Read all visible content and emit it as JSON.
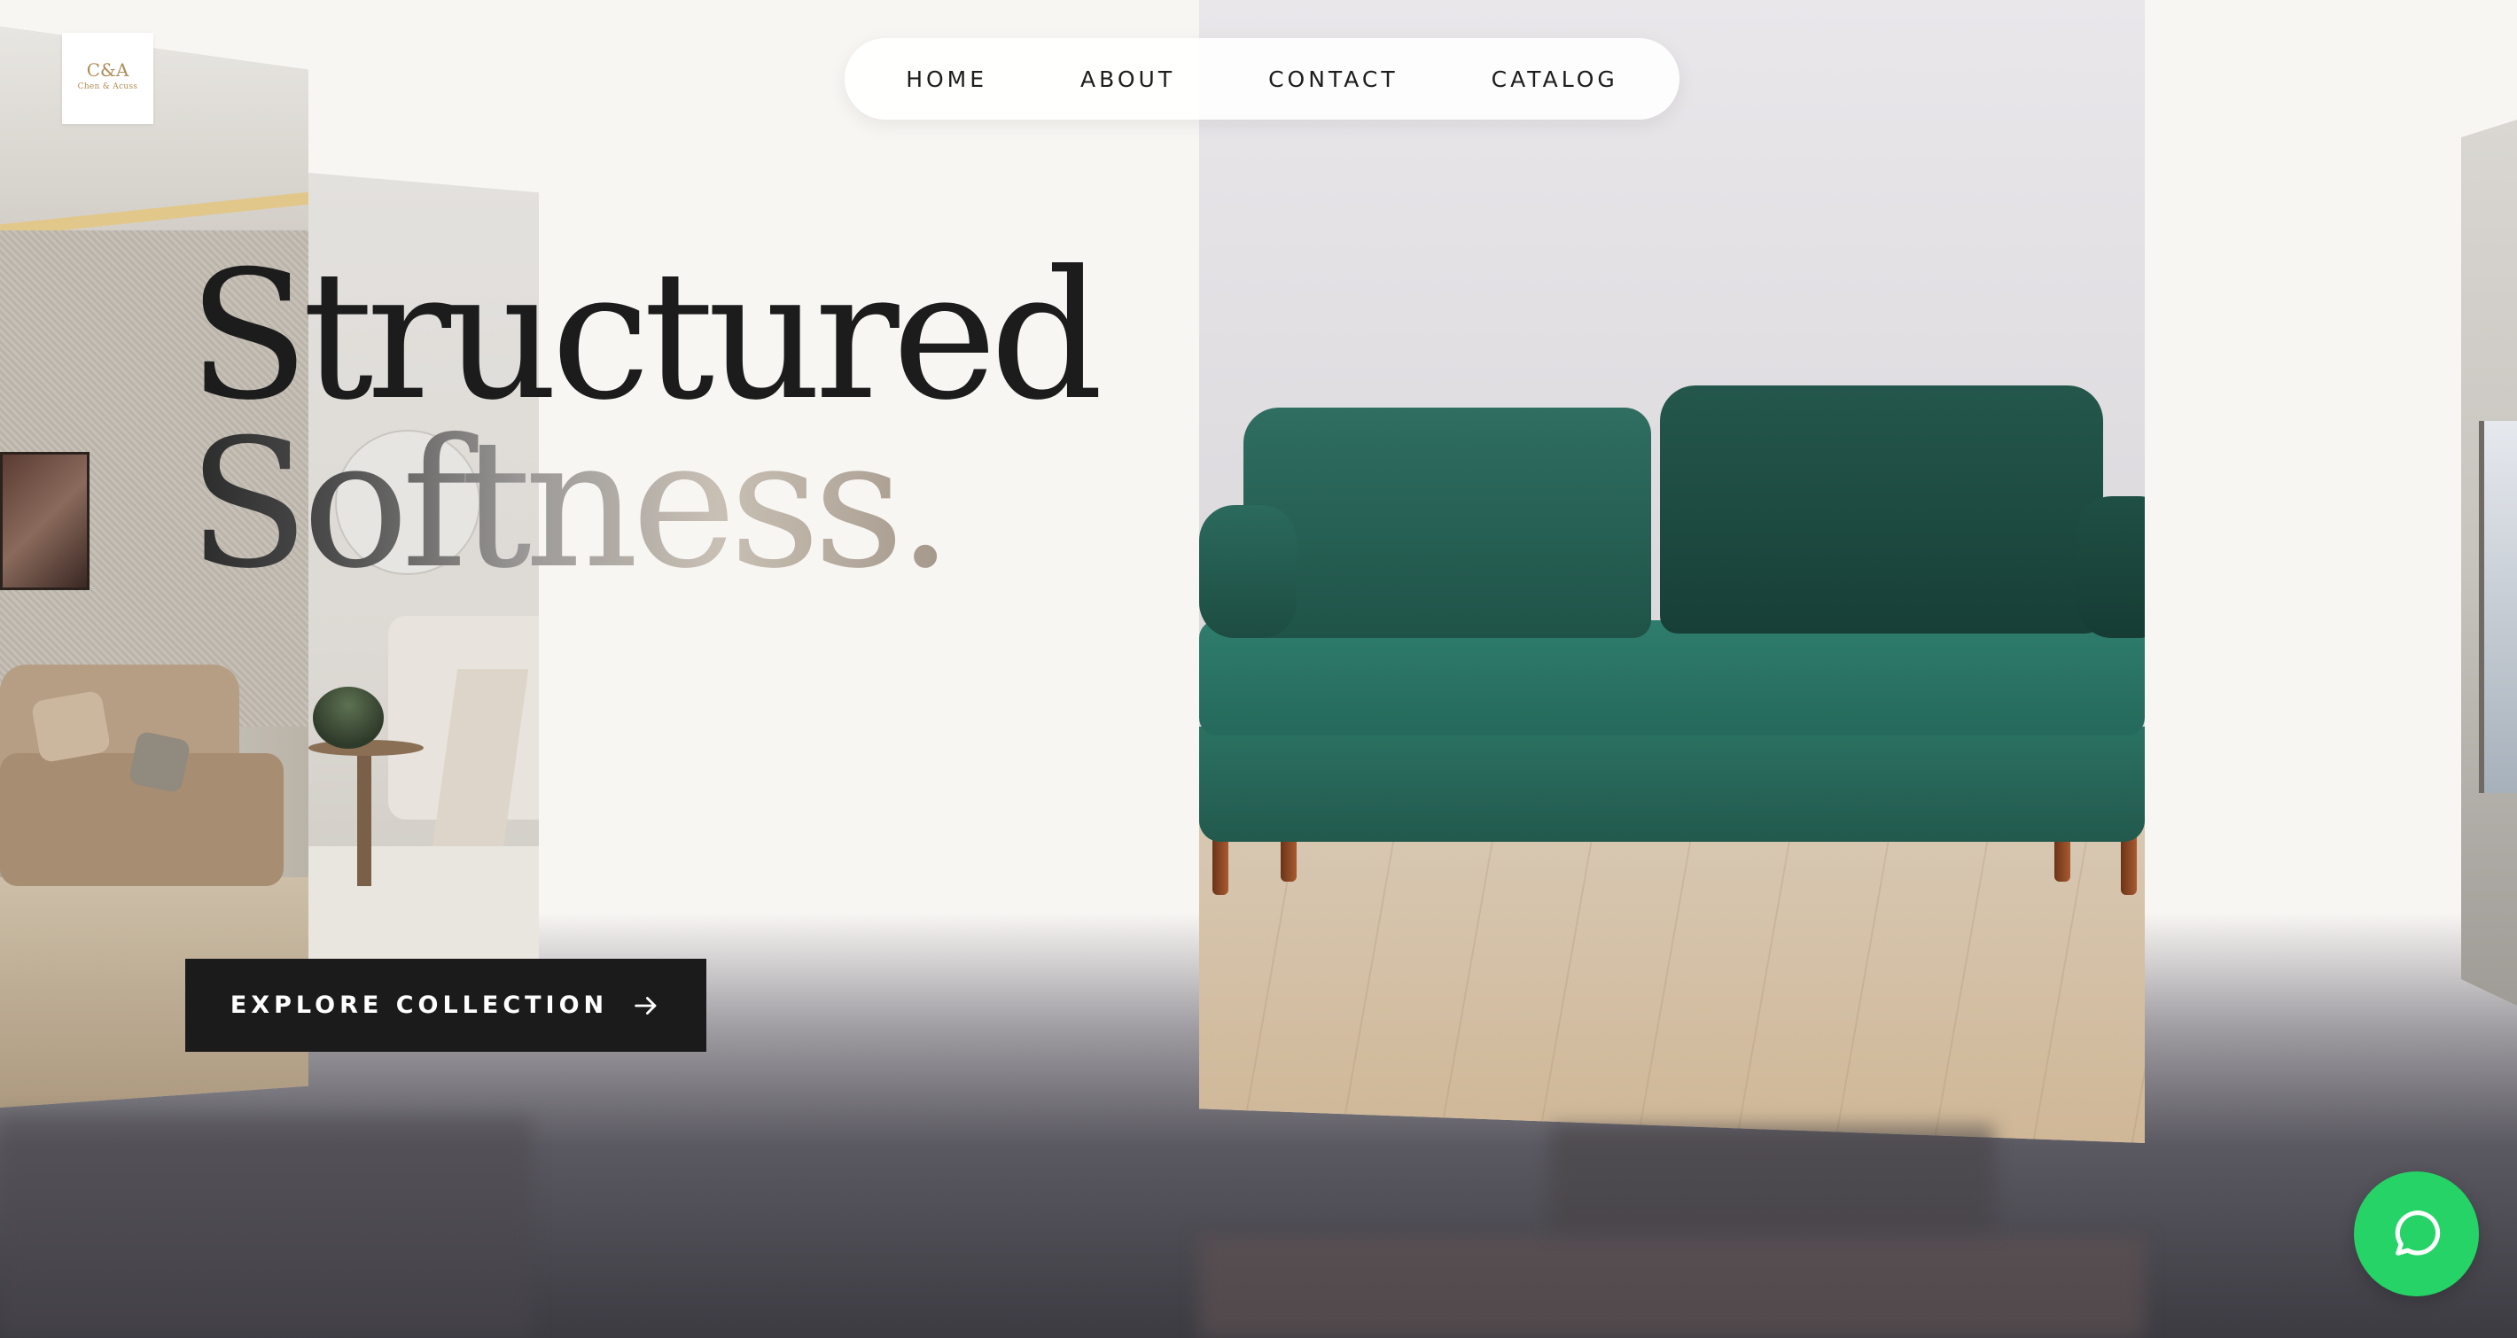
{
  "brand": {
    "logo_mark": "C&A",
    "logo_text": "Chen & Acuss"
  },
  "nav": {
    "items": [
      {
        "label": "HOME"
      },
      {
        "label": "ABOUT"
      },
      {
        "label": "CONTACT"
      },
      {
        "label": "CATALOG"
      }
    ]
  },
  "hero": {
    "title_line1": "Structured",
    "title_line2": "Softness."
  },
  "cta": {
    "label": "EXPLORE COLLECTION",
    "icon": "arrow-right-icon"
  },
  "chat": {
    "icon": "chat-bubble-icon",
    "color": "#25d366"
  },
  "colors": {
    "background": "#f8f6f3",
    "text_dark": "#1c1c1c",
    "sofa_green": "#25695b",
    "button_dark": "#1b1b1b"
  }
}
